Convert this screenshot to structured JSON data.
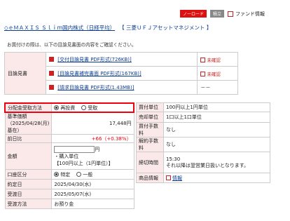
{
  "header": {
    "badge_red": "ノーロード",
    "badge_gray": "積立",
    "fund_info": "ファンド情報"
  },
  "title": {
    "fund_name": "◇ｅＭＡＸＩＳ Ｓｌｉｍ国内株式（日経平均）",
    "company": "【 三菱ＵＦＪアセットマネジメント 】"
  },
  "intro": "お買付けの際は、以下の目論見書面の内容をご確認ください。",
  "docs": {
    "label": "目論見書",
    "rows": [
      {
        "link": "[交付目論見書 PDF形式(726KB)]",
        "status": "未確認"
      },
      {
        "link": "[目論見書補完書面 PDF形式(167KB)]",
        "status": "未確認"
      },
      {
        "link": "[請求目論見書 PDF形式(1.43MB)]",
        "status": "－－"
      }
    ]
  },
  "form": {
    "distribution_label": "分配金受取方法",
    "reinvest": "再投資",
    "receive": "受取",
    "nav_label": "基準価額（2025/04/28(月)基在）",
    "nav_value": "17,448円",
    "prev_label": "前日比",
    "prev_value": "+66（+0.38%）",
    "amount_label": "金額",
    "amount_unit": "円",
    "buy_unit_label": "・購入単位",
    "buy_unit_value": "【100円以上（1円単位）】",
    "account_label": "口座区分",
    "account_specific": "特定",
    "account_general": "一般",
    "contract_label": "約定日",
    "contract_value": "2025/04/30(水)",
    "settle_label": "受渡日",
    "settle_value": "2025/05/07(水)",
    "receipt_label": "受渡方法",
    "receipt_value": "お預り金"
  },
  "right": {
    "buy_unit_label": "買付単位",
    "buy_unit_value": "100円以上1円単位",
    "sell_unit_label": "売却単位",
    "sell_unit_value": "1口以上1口単位",
    "buy_fee_label": "買付手数料",
    "buy_fee_value": "なし",
    "sell_fee_label": "解約手数料",
    "sell_fee_value": "なし",
    "cutoff_label": "締切時間",
    "cutoff_time": "15:30",
    "cutoff_note": "それ以降は翌営業日扱いとなります。",
    "product_info_label": "商品情報",
    "product_info_value": "情報"
  }
}
